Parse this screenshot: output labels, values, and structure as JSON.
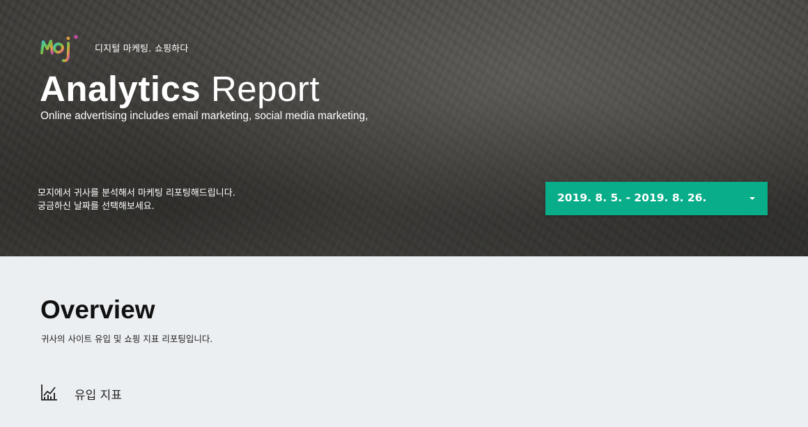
{
  "header": {
    "logo_text": "moji",
    "tagline": "디지털 마케팅. 쇼핑하다",
    "title_bold": "Analytics",
    "title_light": "Report",
    "subtitle": "Online advertising includes email marketing, social media marketing,",
    "intro_line1": "모지에서 귀사를 분석해서 마케팅 리포팅해드립니다.",
    "intro_line2": "궁금하신 날짜를 선택해보세요.",
    "date_range": {
      "selected": "2019. 8. 5. - 2019. 8. 26.",
      "accent_color": "#0aad8a"
    }
  },
  "overview": {
    "title": "Overview",
    "description": "귀사의 사이트 유입 및 쇼핑 지표 리포팅입니다.",
    "section": {
      "icon": "line-chart-icon",
      "label": "유입 지표"
    }
  }
}
